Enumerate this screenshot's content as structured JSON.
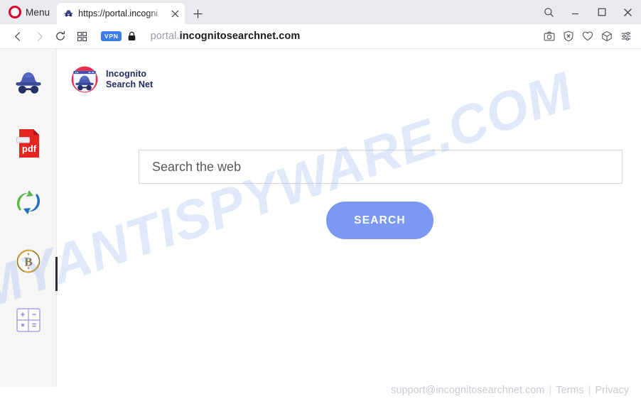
{
  "browser": {
    "name": "Opera",
    "menu_label": "Menu",
    "menu_icon": "opera-logo-icon",
    "tab": {
      "title": "https://portal.incogni",
      "favicon": "incognito-hat-favicon",
      "close_icon": "close-icon"
    },
    "new_tab_icon": "plus-icon",
    "window_controls": [
      {
        "name": "search-icon",
        "glyph": "search"
      },
      {
        "name": "minimize-icon",
        "glyph": "minimize"
      },
      {
        "name": "maximize-icon",
        "glyph": "maximize"
      },
      {
        "name": "close-window-icon",
        "glyph": "close"
      }
    ],
    "address_bar": {
      "back_icon": "back-arrow-icon",
      "forward_icon": "forward-arrow-icon",
      "reload_icon": "reload-icon",
      "tab_grid_icon": "tab-grid-icon",
      "vpn_badge": "VPN",
      "lock_icon": "padlock-icon",
      "url_prefix": "portal.",
      "url_domain": "incognitosearchnet.com",
      "url_full": "portal.incognitosearchnet.com",
      "right_icons": [
        {
          "name": "snapshot-camera-icon"
        },
        {
          "name": "ad-blocker-shield-icon"
        },
        {
          "name": "heart-icon"
        },
        {
          "name": "cube-icon"
        },
        {
          "name": "easy-setup-sliders-icon"
        }
      ]
    },
    "sidebar": {
      "toggle_icon": "chevron-left-icon",
      "items": [
        {
          "name": "sidebar-item-incognito-hat",
          "icon": "incognito-hat-icon"
        },
        {
          "name": "sidebar-item-pdf",
          "icon": "pdf-file-icon",
          "label": "pdf"
        },
        {
          "name": "sidebar-item-converter",
          "icon": "green-blue-swap-arrows-icon"
        },
        {
          "name": "sidebar-item-bitcoin",
          "icon": "bitcoin-coin-icon"
        },
        {
          "name": "sidebar-item-calculator",
          "icon": "calculator-icon"
        }
      ]
    }
  },
  "page": {
    "logo": {
      "icon": "incognito-search-net-logo-icon",
      "line1": "Incognito",
      "line2": "Search Net"
    },
    "search": {
      "placeholder": "Search the web",
      "value": "",
      "button_label": "SEARCH"
    },
    "footer": {
      "email": "support@incognitosearchnet.com",
      "separator": "|",
      "terms": "Terms",
      "privacy": "Privacy"
    }
  },
  "watermark": {
    "text": "MYANTISPYWARE.COM"
  },
  "colors": {
    "brand_navy": "#232a63",
    "button_blue": "#7b99f2",
    "vpn_blue": "#3b7df0",
    "opera_red": "#d7002b",
    "sidebar_bg": "#f6f6f7",
    "watermark_blue": "#78a0eb",
    "footer_gray": "#c7ccd3"
  }
}
